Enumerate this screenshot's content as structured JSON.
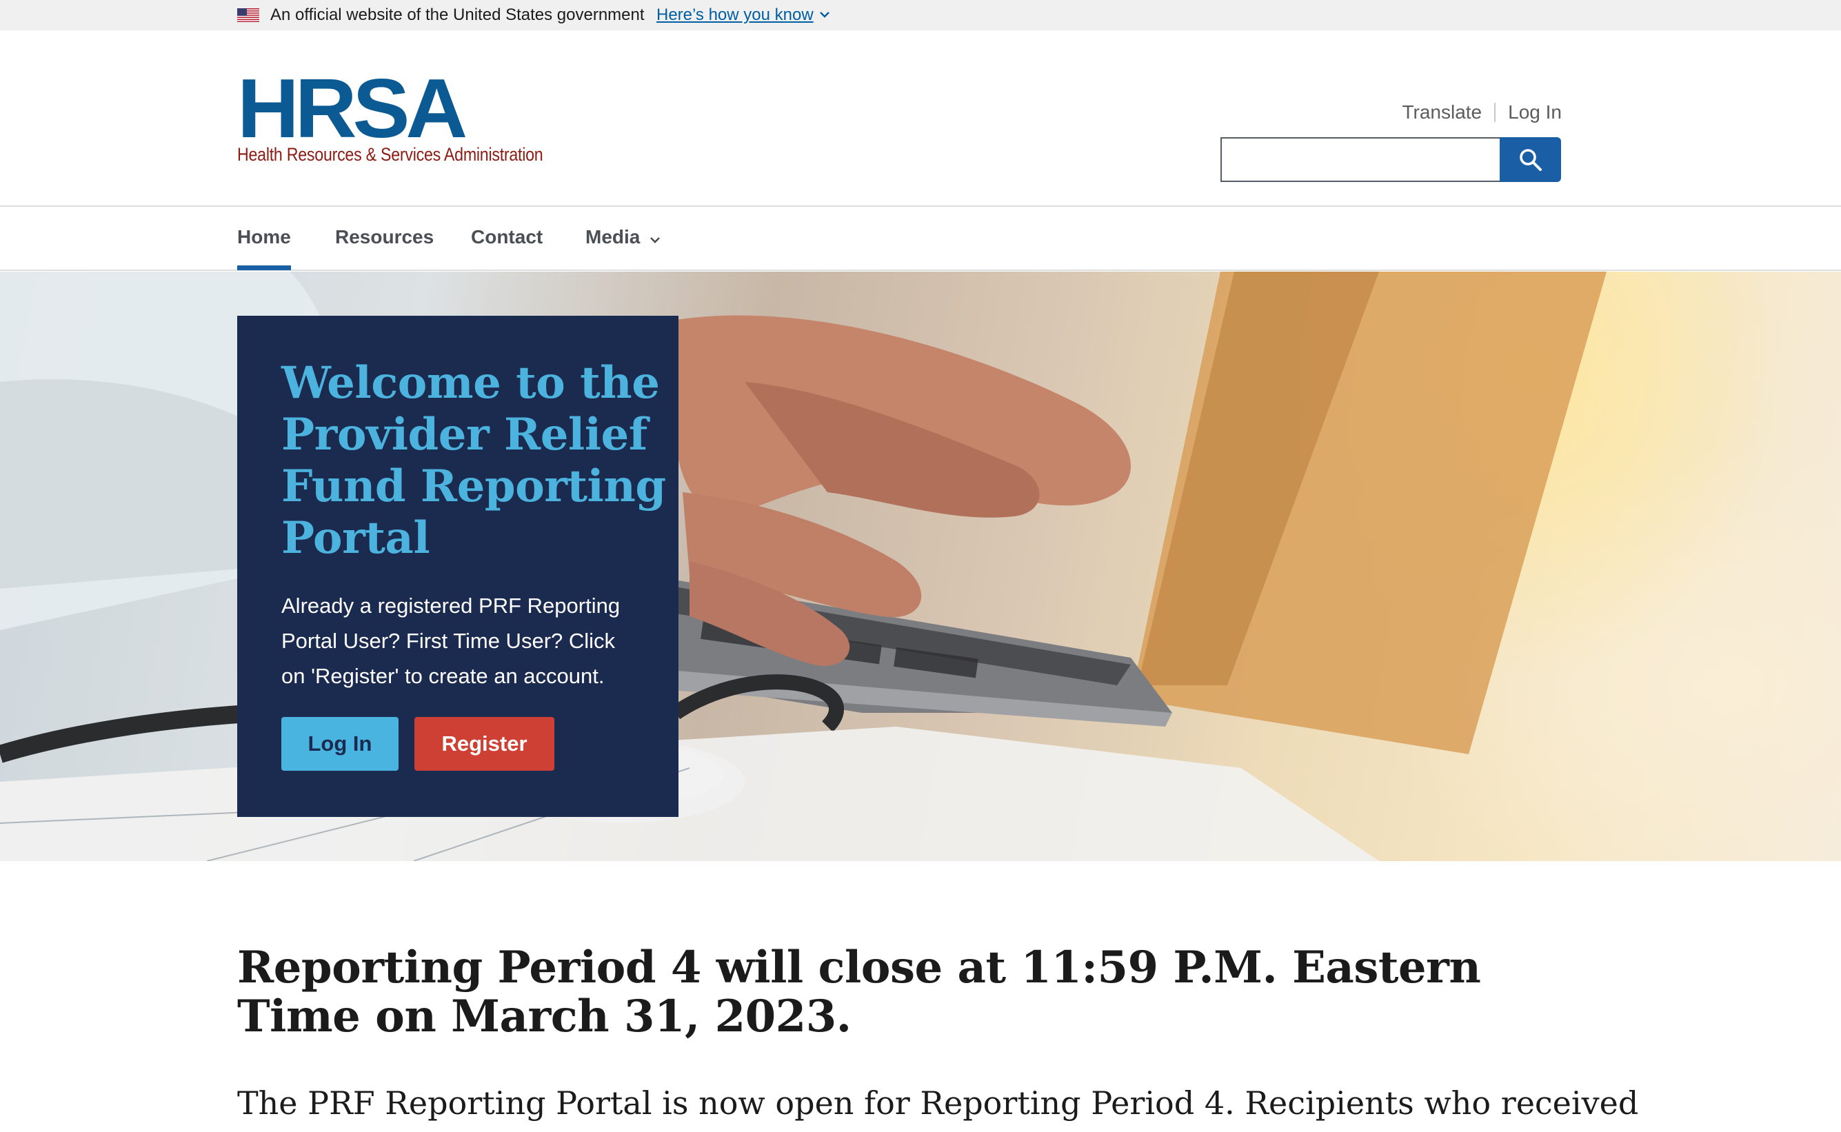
{
  "gov_banner": {
    "official_text": "An official website of the United States government",
    "how_you_know": "Here’s how you know"
  },
  "header": {
    "logo_letters": "HRSA",
    "logo_tagline": "Health Resources & Services Administration",
    "translate": "Translate",
    "login": "Log In",
    "search_value": ""
  },
  "nav": {
    "items": [
      "Home",
      "Resources",
      "Contact",
      "Media"
    ],
    "active": "Home"
  },
  "hero": {
    "title": "Welcome to the Provider Relief Fund Reporting Portal",
    "description": "Already a registered PRF Reporting Portal User? First Time User? Click on 'Register' to create an account.",
    "login_button": "Log In",
    "register_button": "Register"
  },
  "main": {
    "title": "Reporting Period 4 will close at 11:59 P.M. Eastern Time on March 31, 2023.",
    "paragraph": "The PRF Reporting Portal is now open for Reporting Period 4. Recipients who received"
  },
  "colors": {
    "brand_blue": "#0b5a93",
    "brand_red": "#8c1c13",
    "hero_panel": "#1b2b4f",
    "hero_title": "#4cb2de",
    "login_button": "#4ab4e0",
    "register_button": "#cd4033",
    "search_button": "#1a5ea6"
  },
  "icons": {
    "flag": "us-flag-icon",
    "chevron": "chevron-down-icon",
    "search": "search-icon"
  }
}
